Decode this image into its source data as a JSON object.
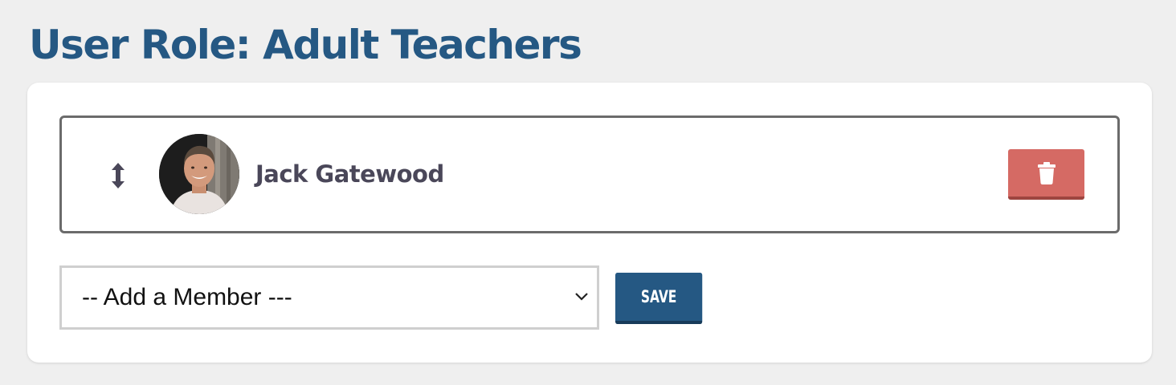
{
  "header": {
    "title": "User Role: Adult Teachers"
  },
  "members": [
    {
      "name": "Jack Gatewood",
      "avatar_icon": "person-photo"
    }
  ],
  "actions": {
    "delete_icon": "trash-icon",
    "drag_icon": "vertical-arrows-icon"
  },
  "add_member": {
    "selected": "-- Add a Member ---",
    "save_label": "SAVE"
  },
  "colors": {
    "title": "#255883",
    "delete": "#d56a64",
    "save": "#255883",
    "background": "#efefef"
  }
}
